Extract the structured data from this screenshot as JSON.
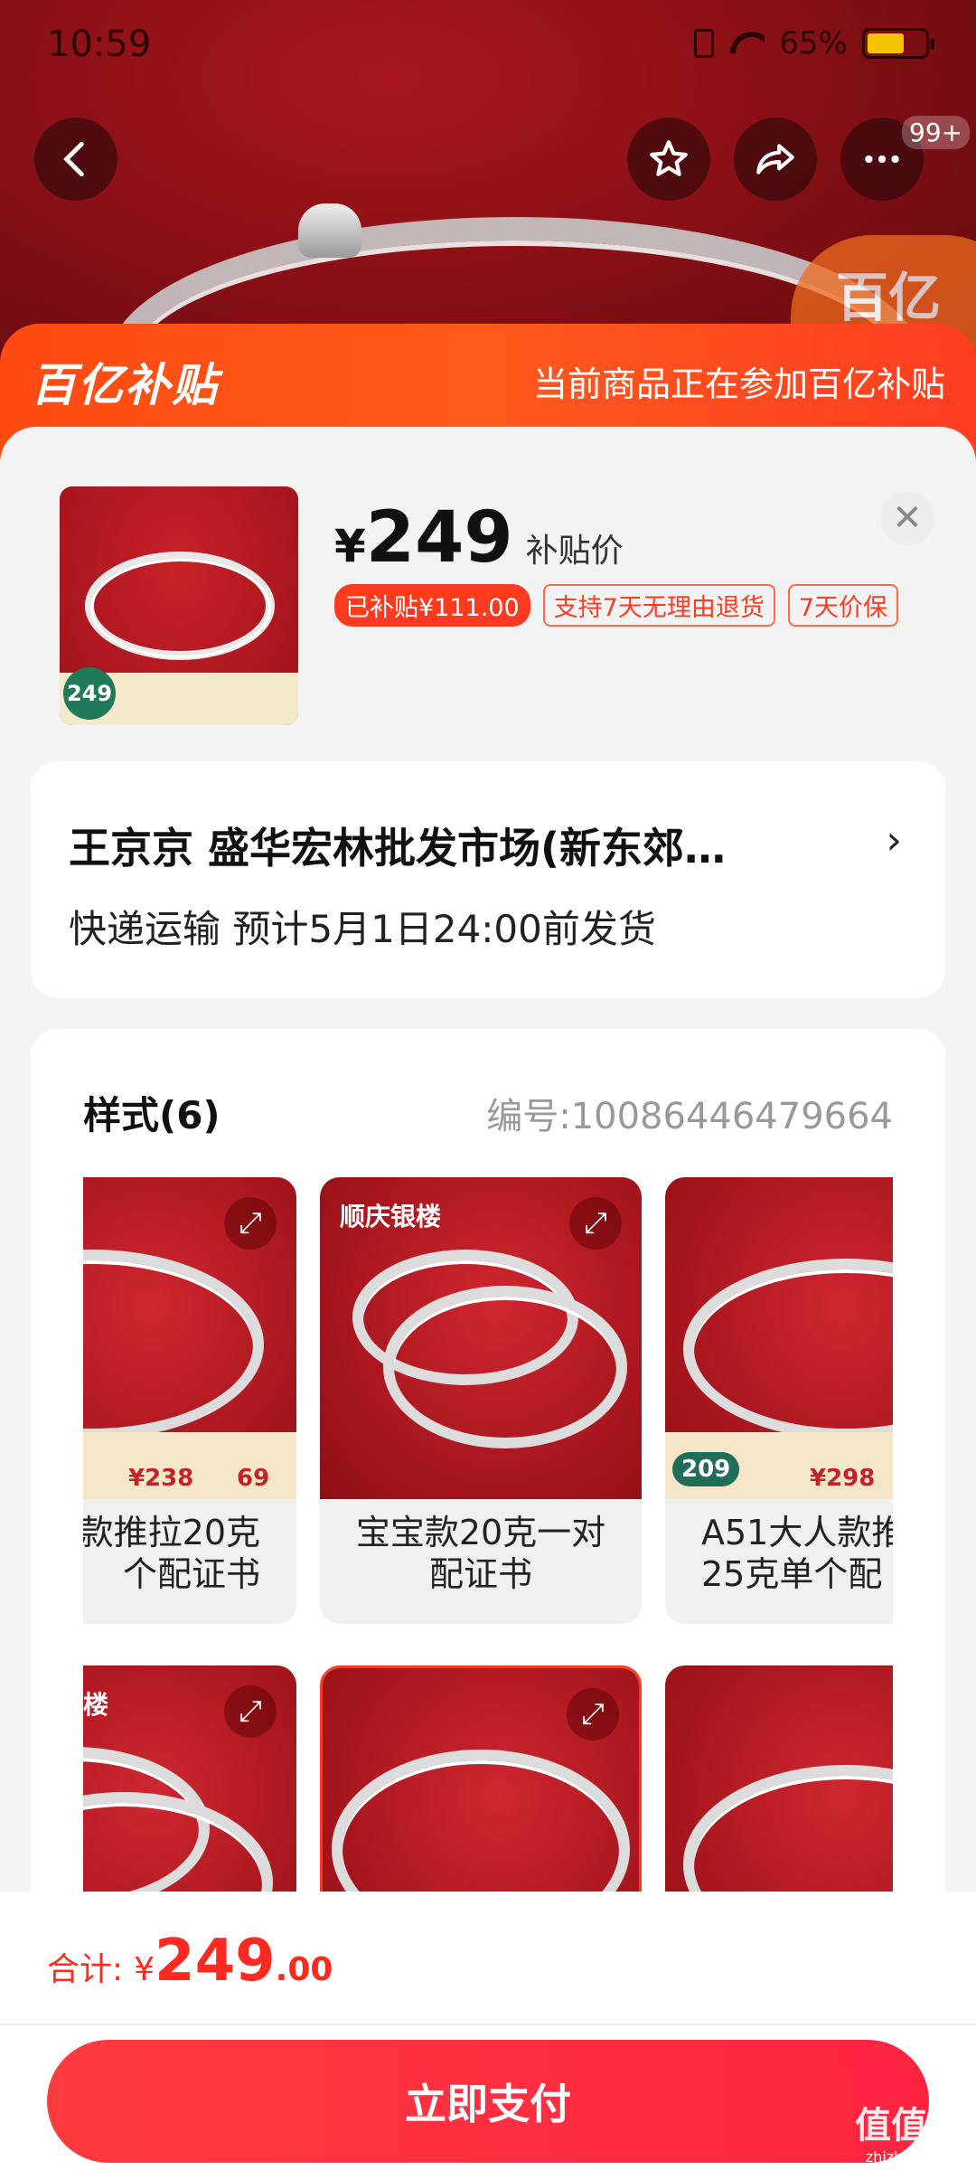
{
  "status_bar": {
    "time": "10:59",
    "battery": "65%"
  },
  "banner": {
    "logo": "百亿补贴",
    "notice": "当前商品正在参加百亿补贴"
  },
  "product": {
    "currency": "¥",
    "price": "249",
    "price_label": "补贴价",
    "tags": [
      "已补贴¥111.00",
      "支持7天无理由退货",
      "7天价保"
    ],
    "thumb_price": "249"
  },
  "shipping": {
    "line1": "王京京  盛华宏林批发市场(新东郊…",
    "line2": "快递运输 预计5月1日24:00前发货"
  },
  "styles": {
    "title": "样式(6)",
    "code": "编号:10086446479664",
    "items": [
      {
        "name": "款推拉20克\n个配证书",
        "low": "¥238",
        "high": "69"
      },
      {
        "name": "宝宝款20克一对\n配证书",
        "brand": "顺庆银楼"
      },
      {
        "name": "A51大人款推\n25克单个配",
        "low": "¥298",
        "badge": "209"
      },
      {
        "name": "",
        "brand": "楼"
      },
      {
        "name": ""
      },
      {
        "name": ""
      }
    ]
  },
  "footer": {
    "total_label": "合计:",
    "currency": "¥",
    "total_int": "249",
    "total_dec": ".00",
    "pay_label": "立即支付"
  },
  "watermark": {
    "big": "值值值",
    "small": "zhizhizhi.com"
  },
  "colors": {
    "accent": "#ff3b1f",
    "banner": "#ff4a12",
    "pay": "#ff2a40"
  }
}
